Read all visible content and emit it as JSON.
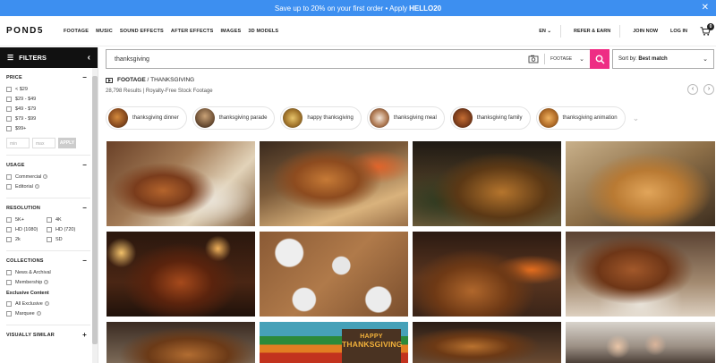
{
  "promo": {
    "text": "Save up to 20% on your first order • Apply",
    "code": "HELLO20",
    "close": "✕"
  },
  "nav": {
    "logo": "POND5",
    "links": [
      "FOOTAGE",
      "MUSIC",
      "SOUND EFFECTS",
      "AFTER EFFECTS",
      "IMAGES",
      "3D MODELS"
    ],
    "lang": "EN",
    "refer": "REFER & EARN",
    "join": "JOIN NOW",
    "login": "LOG IN",
    "cart_count": "0"
  },
  "sidebar": {
    "title": "FILTERS",
    "price": {
      "title": "PRICE",
      "options": [
        "< $29",
        "$29 - $49",
        "$49 - $79",
        "$79 - $99",
        "$99+"
      ],
      "min_placeholder": "min",
      "max_placeholder": "max",
      "apply": "APPLY"
    },
    "usage": {
      "title": "USAGE",
      "options": [
        "Commercial",
        "Editorial"
      ]
    },
    "resolution": {
      "title": "RESOLUTION",
      "options": [
        "5K+",
        "4K",
        "HD (1080)",
        "HD (720)",
        "2k",
        "SD"
      ]
    },
    "collections": {
      "title": "COLLECTIONS",
      "options": [
        "News & Archival",
        "Membership"
      ],
      "exclusive_title": "Exclusive Content",
      "exclusive_options": [
        "All Exclusive",
        "Marquee"
      ]
    },
    "visually_similar": {
      "title": "VISUALLY SIMILAR"
    }
  },
  "search": {
    "query": "thanksgiving",
    "type": "FOOTAGE",
    "sort_label": "Sort by:",
    "sort_value": "Best match"
  },
  "breadcrumb": {
    "category": "FOOTAGE",
    "sep": "/",
    "term": "THANKSGIVING"
  },
  "results_text": "28,798 Results | Royalty-Free Stock Footage",
  "chips": [
    "thanksgiving dinner",
    "thanksgiving parade",
    "happy thanksgiving",
    "thanksgiving meal",
    "thanksgiving family",
    "thanksgiving animation"
  ],
  "tile_text": {
    "line1": "HAPPY",
    "line2": "THANKSGIVING"
  },
  "colors": {
    "promo": "#3d8ff0",
    "search_button": "#ee2d84",
    "filter_header": "#111111"
  }
}
